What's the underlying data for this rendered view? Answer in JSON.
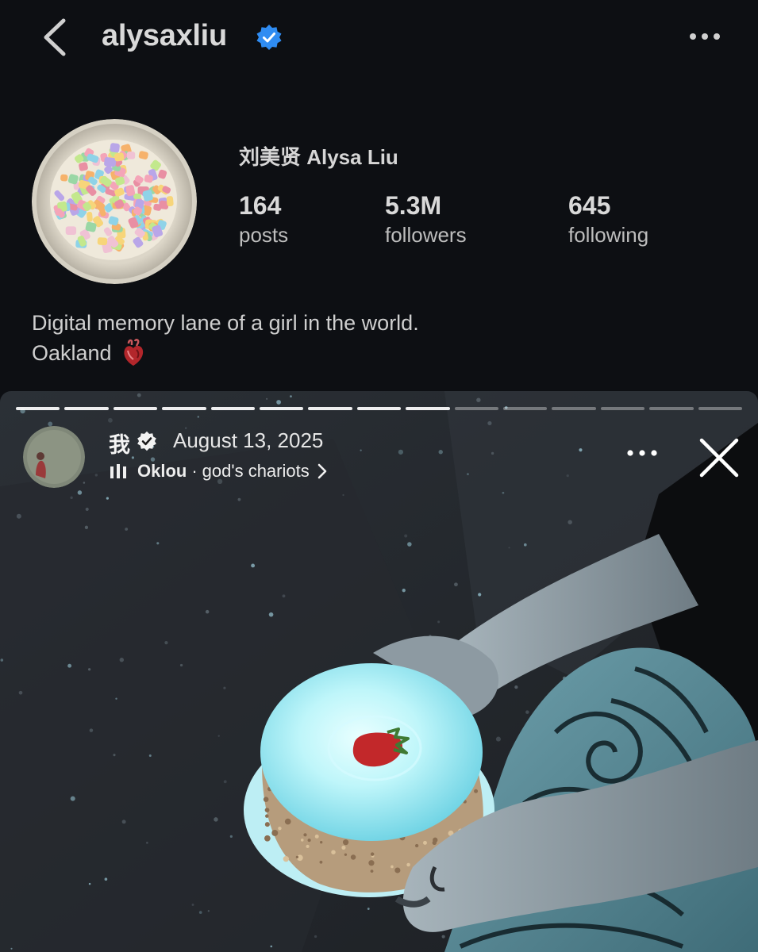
{
  "header": {
    "username": "alysaxliu",
    "back_icon": "chevron-left-icon",
    "verified_icon": "verified-badge-icon",
    "more_icon": "more-horizontal-icon"
  },
  "profile": {
    "full_name": "刘美贤 Alysa Liu",
    "avatar_description": "profile-photo",
    "stats": [
      {
        "value": "164",
        "label": "posts"
      },
      {
        "value": "5.3M",
        "label": "followers"
      },
      {
        "value": "645",
        "label": "following"
      }
    ],
    "bio_line1": "Digital memory lane of a girl in the world.",
    "bio_line2": "Oakland",
    "bio_emoji_icon": "anatomical-heart-icon"
  },
  "story": {
    "progress_total": 15,
    "progress_completed": 9,
    "author_name": "我",
    "date": "August 13, 2025",
    "music_artist": "Oklou",
    "music_separator": "·",
    "music_title": "god's chariots",
    "music_icon": "audio-bars-icon",
    "more_icon": "more-horizontal-icon",
    "close_icon": "close-icon"
  },
  "colors": {
    "background": "#0d0f13",
    "verified_blue": "#2f8cf2",
    "text_primary": "#d9d9d9",
    "text_secondary": "#bdbdbd"
  }
}
